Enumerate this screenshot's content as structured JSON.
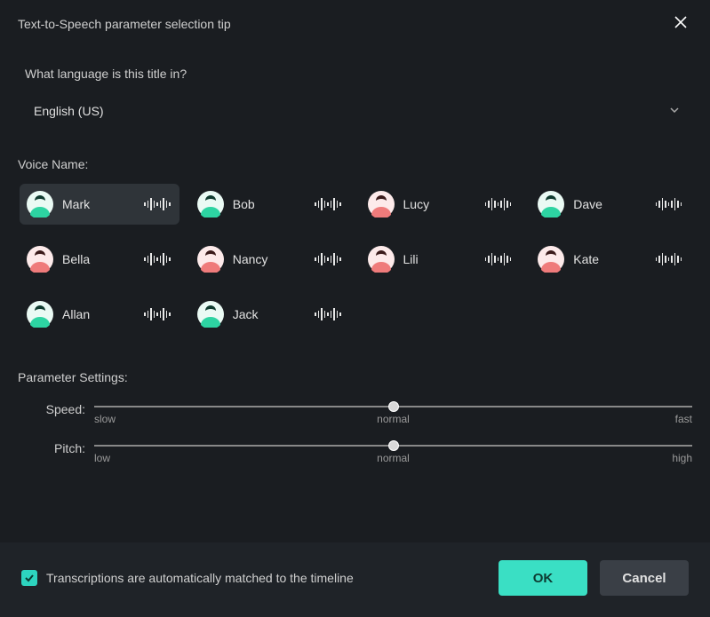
{
  "title": "Text-to-Speech parameter selection tip",
  "language": {
    "prompt": "What language is this title in?",
    "selected": "English (US)"
  },
  "voice_section_label": "Voice Name:",
  "voices": [
    {
      "name": "Mark",
      "avatar_color": "green",
      "selected": true
    },
    {
      "name": "Bob",
      "avatar_color": "green",
      "selected": false
    },
    {
      "name": "Lucy",
      "avatar_color": "pink",
      "selected": false
    },
    {
      "name": "Dave",
      "avatar_color": "green",
      "selected": false
    },
    {
      "name": "Bella",
      "avatar_color": "pink",
      "selected": false
    },
    {
      "name": "Nancy",
      "avatar_color": "pink",
      "selected": false
    },
    {
      "name": "Lili",
      "avatar_color": "pink",
      "selected": false
    },
    {
      "name": "Kate",
      "avatar_color": "pink",
      "selected": false
    },
    {
      "name": "Allan",
      "avatar_color": "green",
      "selected": false
    },
    {
      "name": "Jack",
      "avatar_color": "green",
      "selected": false
    }
  ],
  "parameters": {
    "label": "Parameter Settings:",
    "speed": {
      "name": "Speed:",
      "min_label": "slow",
      "mid_label": "normal",
      "max_label": "fast",
      "value_percent": 50
    },
    "pitch": {
      "name": "Pitch:",
      "min_label": "low",
      "mid_label": "normal",
      "max_label": "high",
      "value_percent": 50
    }
  },
  "footer": {
    "checkbox_label": "Transcriptions are automatically matched to the timeline",
    "checkbox_checked": true,
    "ok_label": "OK",
    "cancel_label": "Cancel"
  },
  "colors": {
    "accent": "#3adfc4",
    "avatar_green": "#2dd4a2",
    "avatar_pink": "#f9c2c2"
  }
}
